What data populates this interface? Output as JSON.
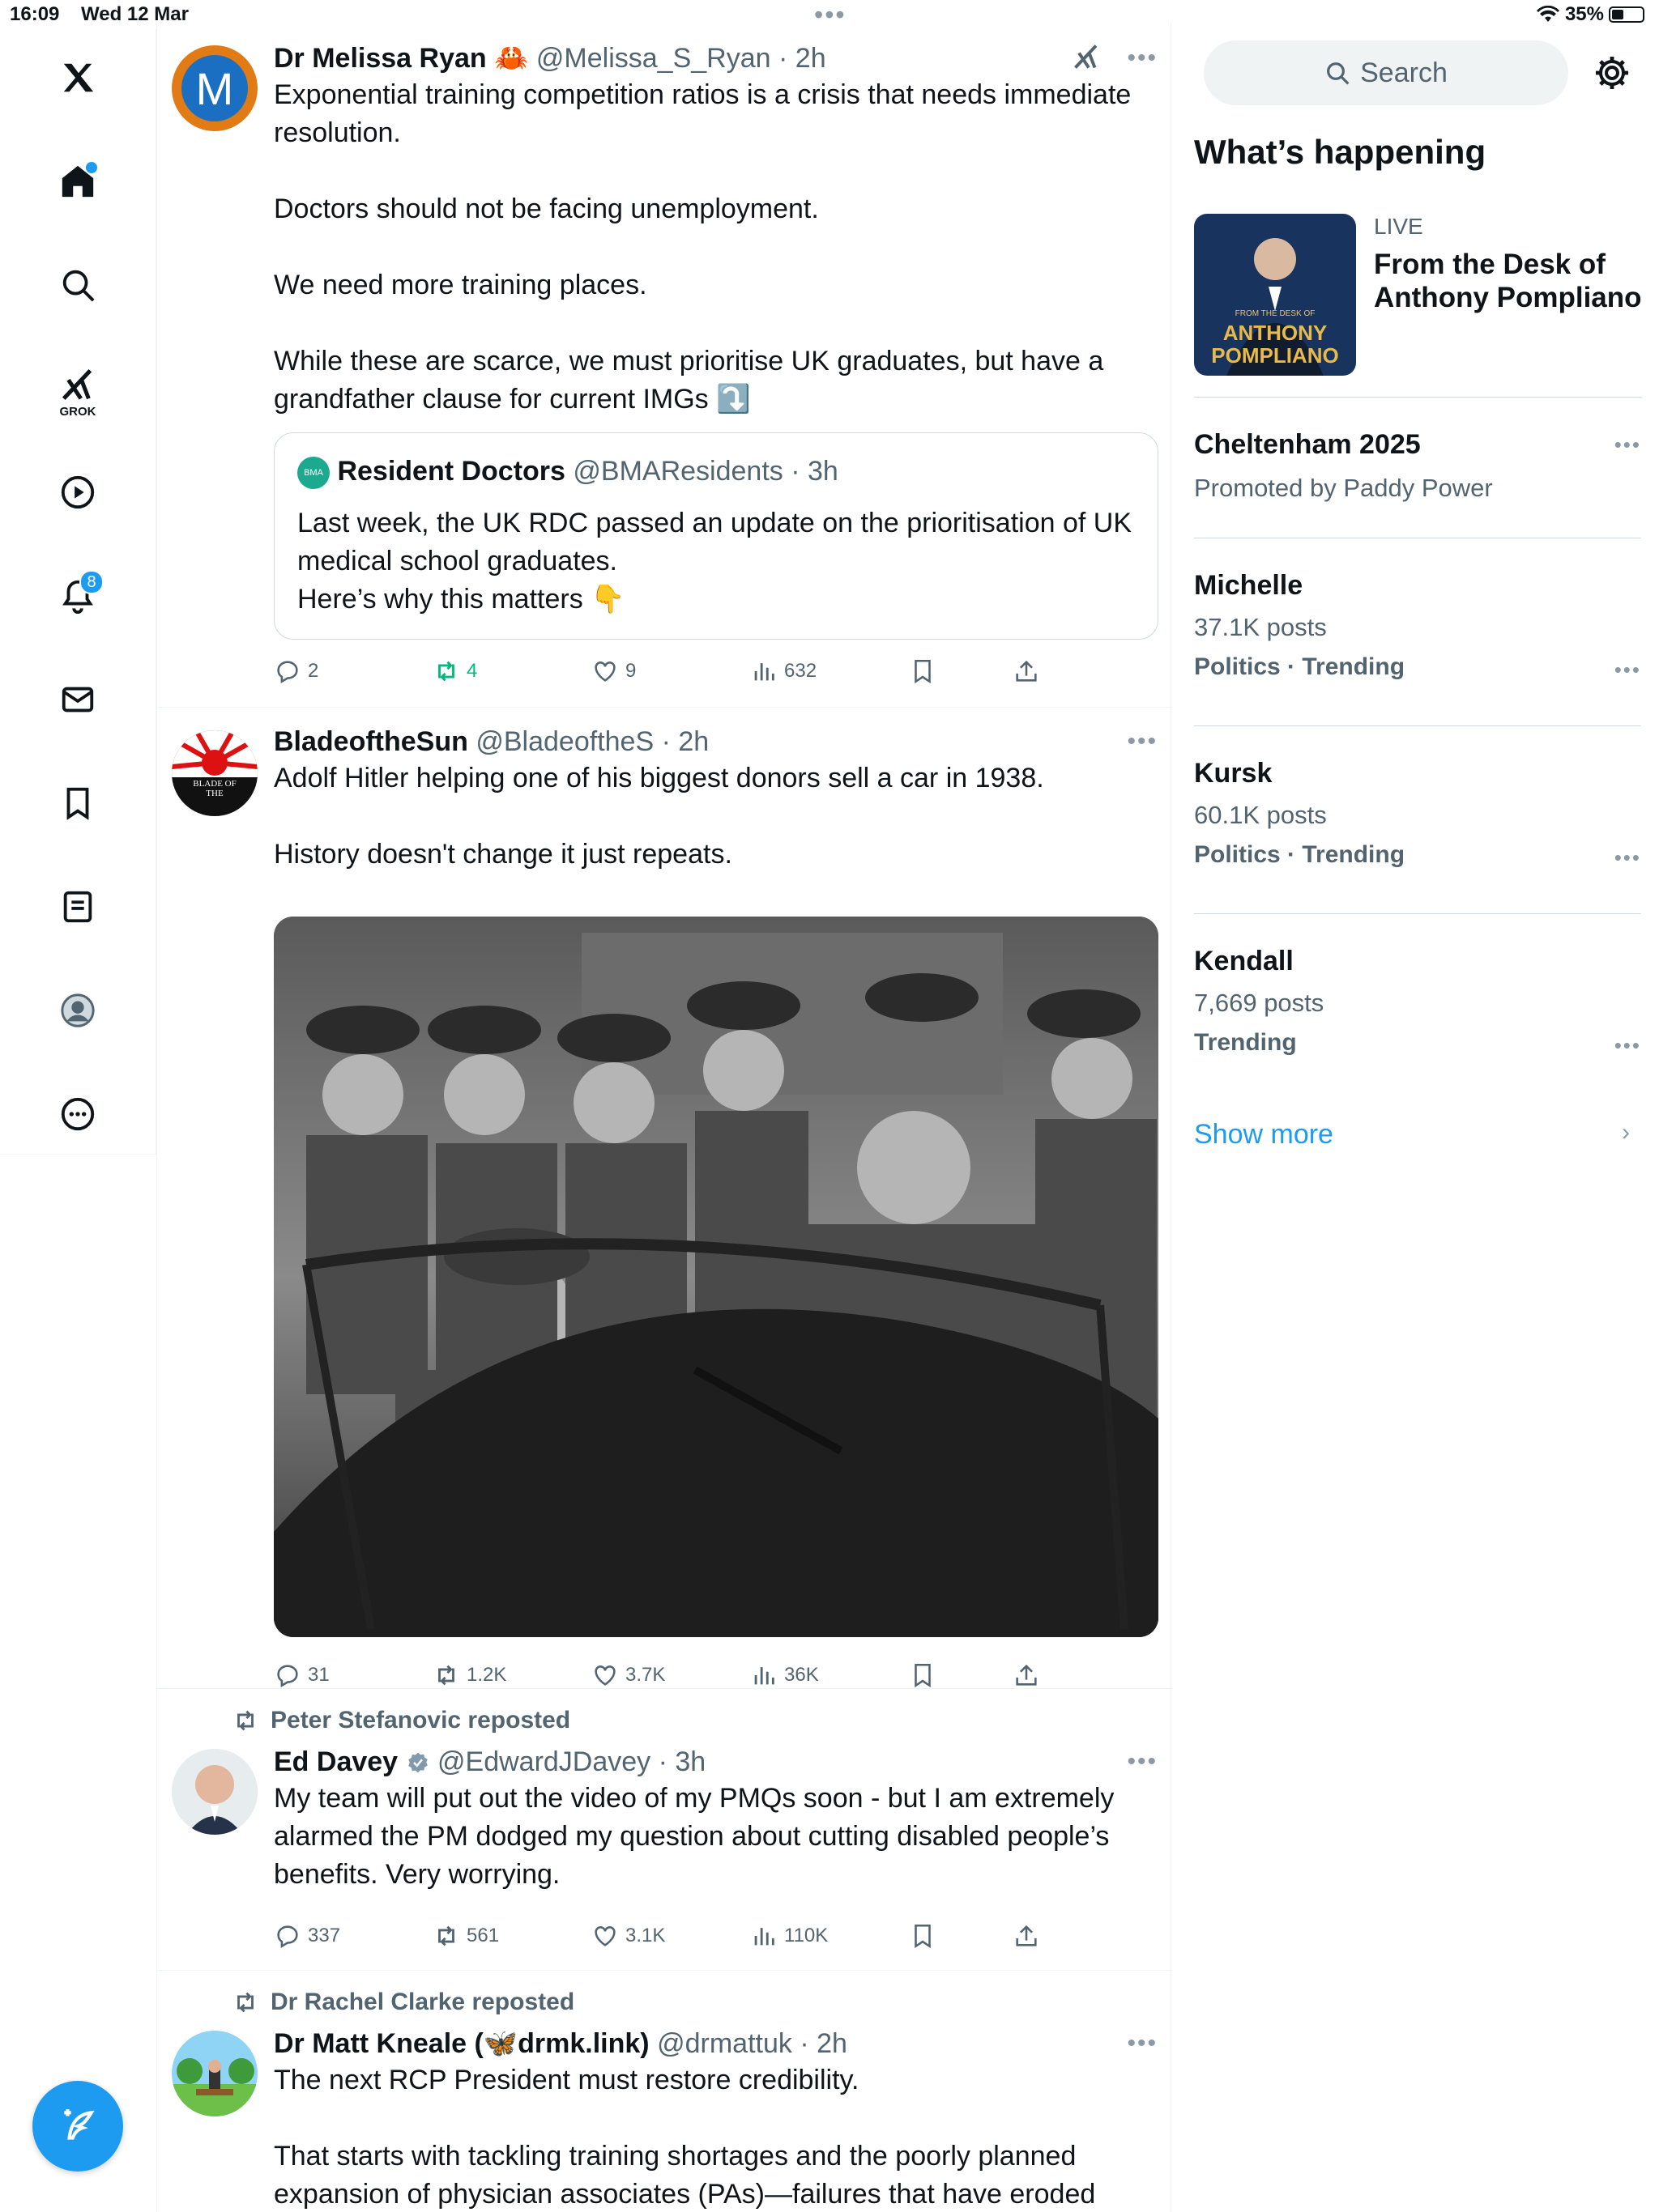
{
  "status": {
    "time": "16:09",
    "date": "Wed 12 Mar",
    "battery": "35%"
  },
  "nav": {
    "notif_count": "8",
    "grok_label": "GROK"
  },
  "posts": [
    {
      "name": "Dr Melissa Ryan",
      "handle": "@Melissa_S_Ryan",
      "time": "2h",
      "avatar_letter": "M",
      "text": "Exponential training competition ratios is a crisis that needs immediate resolution.\n\nDoctors should not be facing unemployment.\n\nWe need more training places.\n\nWhile these are scarce, we must prioritise UK graduates, but have a grandfather clause for current IMGs ⤵️",
      "quote": {
        "badge": "BMA",
        "name": "Resident Doctors",
        "handle": "@BMAResidents",
        "time": "3h",
        "text": "Last week, the UK RDC passed an update on the prioritisation of UK medical school graduates.\nHere’s why this matters 👇"
      },
      "replies": "2",
      "reposts": "4",
      "likes": "9",
      "views": "632"
    },
    {
      "name": "BladeoftheSun",
      "handle": "@BladeoftheS",
      "time": "2h",
      "avatar_text": "BLADE OF THE",
      "text": "Adolf Hitler helping one of his biggest donors sell a car in 1938.\n\nHistory doesn't change it just repeats.",
      "replies": "31",
      "reposts": "1.2K",
      "likes": "3.7K",
      "views": "36K"
    },
    {
      "reposted_by": "Peter Stefanovic reposted",
      "name": "Ed Davey",
      "handle": "@EdwardJDavey",
      "time": "3h",
      "text": "My team will put out the video of my PMQs soon - but I am extremely alarmed the PM dodged my question about cutting disabled people’s benefits. Very worrying.",
      "replies": "337",
      "reposts": "561",
      "likes": "3.1K",
      "views": "110K"
    },
    {
      "reposted_by": "Dr Rachel Clarke reposted",
      "name": "Dr Matt Kneale (🦋drmk.link)",
      "handle": "@drmattuk",
      "time": "2h",
      "text": "The next RCP President must restore credibility.\n\nThat starts with tackling training shortages and the poorly planned expansion of physician associates (PAs)—failures that have eroded"
    }
  ],
  "right": {
    "search_placeholder": "Search",
    "title": "What’s happening",
    "live": {
      "label": "LIVE",
      "title": "From the Desk of Anthony Pompliano",
      "thumb_small": "FROM THE DESK OF",
      "thumb_big1": "ANTHONY",
      "thumb_big2": "POMPLIANO"
    },
    "promo": {
      "title": "Cheltenham 2025",
      "sub": "Promoted by Paddy Power"
    },
    "trends": [
      {
        "title": "Michelle",
        "posts": "37.1K posts",
        "cat": "Politics · Trending"
      },
      {
        "title": "Kursk",
        "posts": "60.1K posts",
        "cat": "Politics · Trending"
      },
      {
        "title": "Kendall",
        "posts": "7,669 posts",
        "cat": "Trending"
      }
    ],
    "show_more": "Show more"
  },
  "colors": {
    "accent": "#1d9bf0",
    "repost_green": "#00ba7c",
    "muted": "#536471"
  }
}
